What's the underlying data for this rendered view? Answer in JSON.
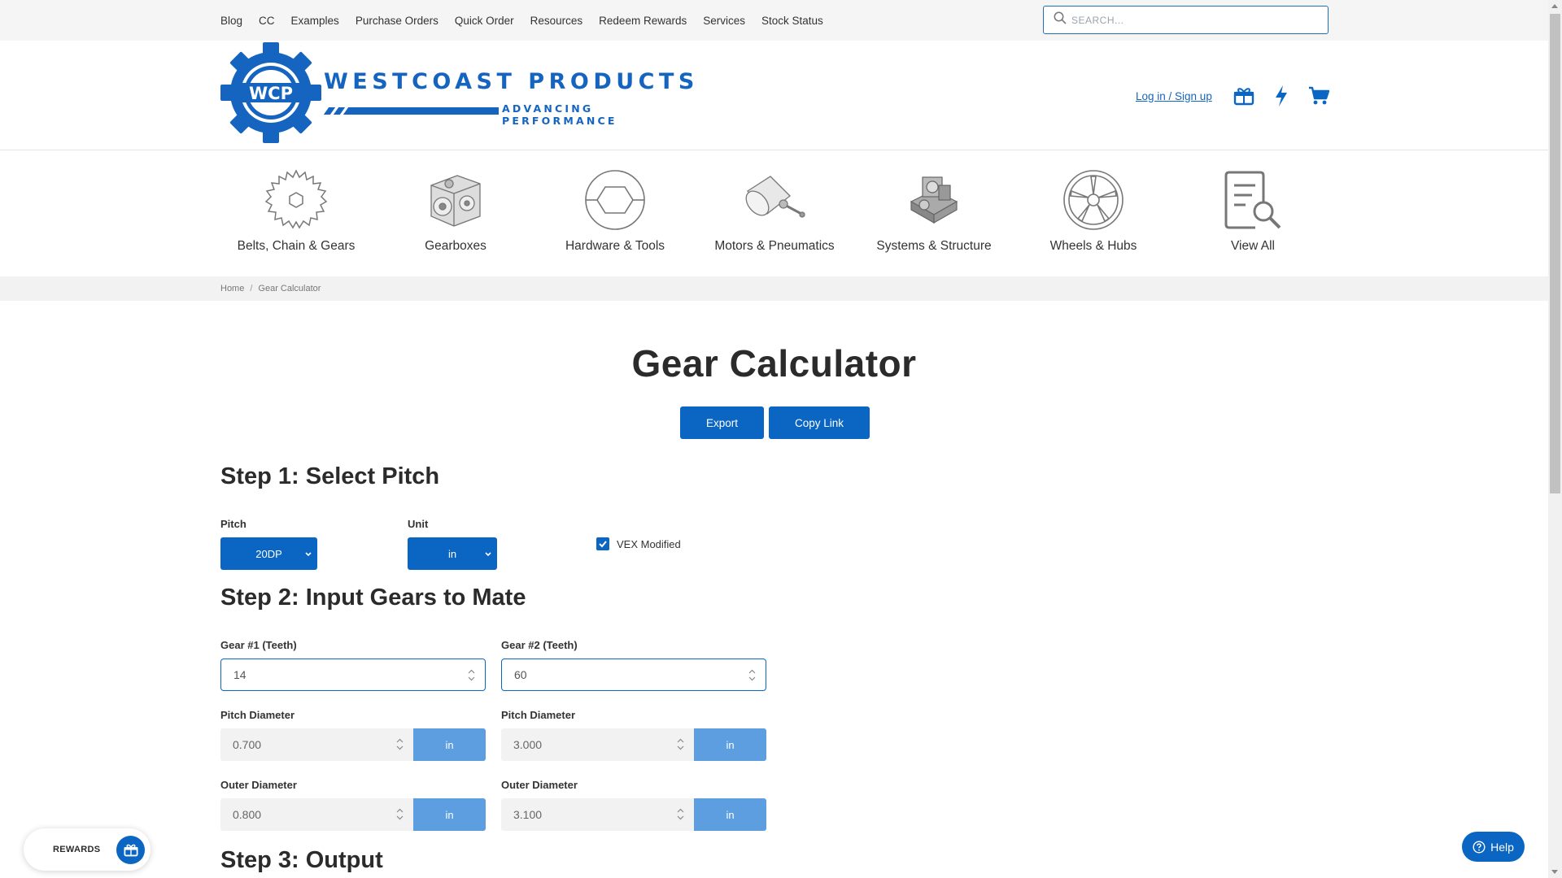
{
  "topbar": {
    "links": [
      "Blog",
      "CC",
      "Examples",
      "Purchase Orders",
      "Quick Order",
      "Resources",
      "Redeem Rewards",
      "Services",
      "Stock Status"
    ],
    "search_placeholder": "SEARCH..."
  },
  "header": {
    "logo_badge": "WCP",
    "logo_title": "WESTCOAST PRODUCTS",
    "logo_subtitle": "ADVANCING PERFORMANCE",
    "login_label": "Log in / Sign up"
  },
  "categories": [
    {
      "label": "Belts, Chain & Gears",
      "icon": "gear-icon"
    },
    {
      "label": "Gearboxes",
      "icon": "gearbox-icon"
    },
    {
      "label": "Hardware & Tools",
      "icon": "hex-socket-icon"
    },
    {
      "label": "Motors & Pneumatics",
      "icon": "motor-icon"
    },
    {
      "label": "Systems & Structure",
      "icon": "assembly-icon"
    },
    {
      "label": "Wheels & Hubs",
      "icon": "wheel-icon"
    },
    {
      "label": "View All",
      "icon": "view-all-icon"
    }
  ],
  "breadcrumb": {
    "home": "Home",
    "current": "Gear Calculator"
  },
  "main": {
    "title": "Gear Calculator",
    "export_label": "Export",
    "copy_link_label": "Copy Link"
  },
  "step1": {
    "heading": "Step 1: Select Pitch",
    "pitch_label": "Pitch",
    "pitch_value": "20DP",
    "unit_label": "Unit",
    "unit_value": "in",
    "vex_label": "VEX Modified",
    "vex_checked": true
  },
  "step2": {
    "heading": "Step 2: Input Gears to Mate",
    "gear1": {
      "teeth_label": "Gear #1 (Teeth)",
      "teeth_value": "14",
      "pitch_diameter_label": "Pitch Diameter",
      "pitch_diameter_value": "0.700",
      "outer_diameter_label": "Outer Diameter",
      "outer_diameter_value": "0.800",
      "unit": "in"
    },
    "gear2": {
      "teeth_label": "Gear #2 (Teeth)",
      "teeth_value": "60",
      "pitch_diameter_label": "Pitch Diameter",
      "pitch_diameter_value": "3.000",
      "outer_diameter_label": "Outer Diameter",
      "outer_diameter_value": "3.100",
      "unit": "in"
    }
  },
  "step3": {
    "heading": "Step 3: Output"
  },
  "floating": {
    "rewards_label": "REWARDS",
    "help_label": "Help"
  },
  "colors": {
    "brand_blue": "#0a66c2",
    "logo_blue": "#1565c0",
    "unit_button_blue": "#5c9ee0"
  }
}
